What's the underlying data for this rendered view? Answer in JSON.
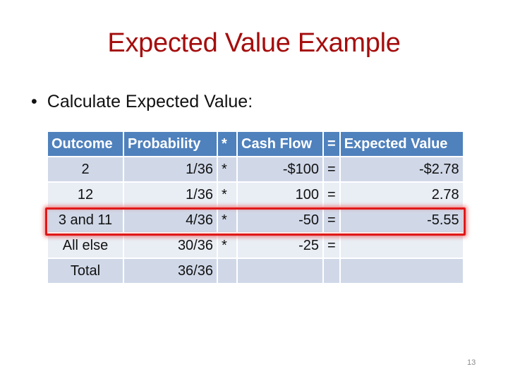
{
  "slide": {
    "title": "Expected Value Example",
    "bullet": "Calculate Expected Value:",
    "bullet_marker": "•",
    "page_number": "13",
    "accent_color": "#a50d0d",
    "header_color": "#4f81bd",
    "highlight_color": "#e01818"
  },
  "table": {
    "headers": [
      "Outcome",
      "Probability",
      "*",
      "Cash Flow",
      "=",
      "Expected Value"
    ],
    "rows": [
      [
        "2",
        "1/36",
        "*",
        "-$100",
        "=",
        "-$2.78"
      ],
      [
        "12",
        "1/36",
        "*",
        "100",
        "=",
        "2.78"
      ],
      [
        "3 and 11",
        "4/36",
        "*",
        "-50",
        "=",
        "-5.55"
      ],
      [
        "All else",
        "30/36",
        "*",
        "-25",
        "=",
        ""
      ],
      [
        "Total",
        "36/36",
        "",
        "",
        "",
        ""
      ]
    ],
    "highlighted_row": 2
  }
}
